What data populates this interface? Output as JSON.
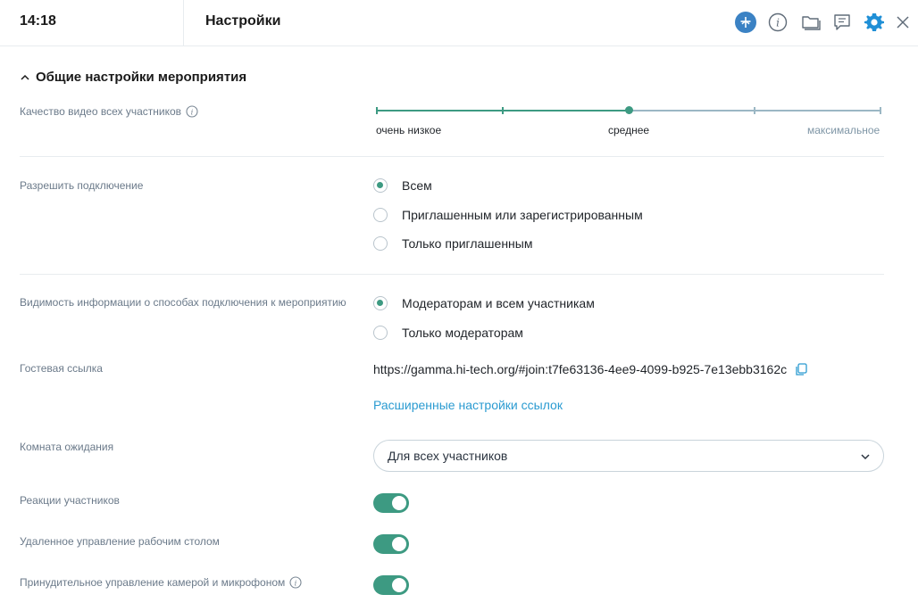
{
  "header": {
    "time": "14:18",
    "title": "Настройки"
  },
  "icons": {
    "network": "network-icon",
    "info": "info-icon",
    "folder": "folder-icon",
    "chat": "chat-icon",
    "settings": "gear-icon",
    "close": "close-icon"
  },
  "colors": {
    "accent": "#3d9a82",
    "link": "#2b9bd1",
    "settings_active": "#1f8fd6",
    "network_bg": "#3b82c4",
    "label": "#6b7a8a"
  },
  "section": {
    "title": "Общие настройки мероприятия"
  },
  "video_quality": {
    "label": "Качество видео всех участников",
    "levels": [
      "очень низкое",
      "среднее",
      "максимальное"
    ],
    "selected": "среднее"
  },
  "allow_connection": {
    "label": "Разрешить подключение",
    "options": [
      "Всем",
      "Приглашенным или зарегистрированным",
      "Только приглашенным"
    ],
    "selected": "Всем"
  },
  "visibility": {
    "label": "Видимость информации о способах подключения к мероприятию",
    "options": [
      "Модераторам и всем участникам",
      "Только модераторам"
    ],
    "selected": "Модераторам и всем участникам"
  },
  "guest_link": {
    "label": "Гостевая ссылка",
    "url": "https://gamma.hi-tech.org/#join:t7fe63136-4ee9-4099-b925-7e13ebb3162c",
    "advanced": "Расширенные настройки ссылок"
  },
  "waiting_room": {
    "label": "Комната ожидания",
    "value": "Для всех участников"
  },
  "toggles": {
    "reactions": {
      "label": "Реакции участников",
      "on": true
    },
    "remote_desktop": {
      "label": "Удаленное управление рабочим столом",
      "on": true
    },
    "force_av": {
      "label": "Принудительное управление камерой и микрофоном",
      "on": true
    }
  }
}
